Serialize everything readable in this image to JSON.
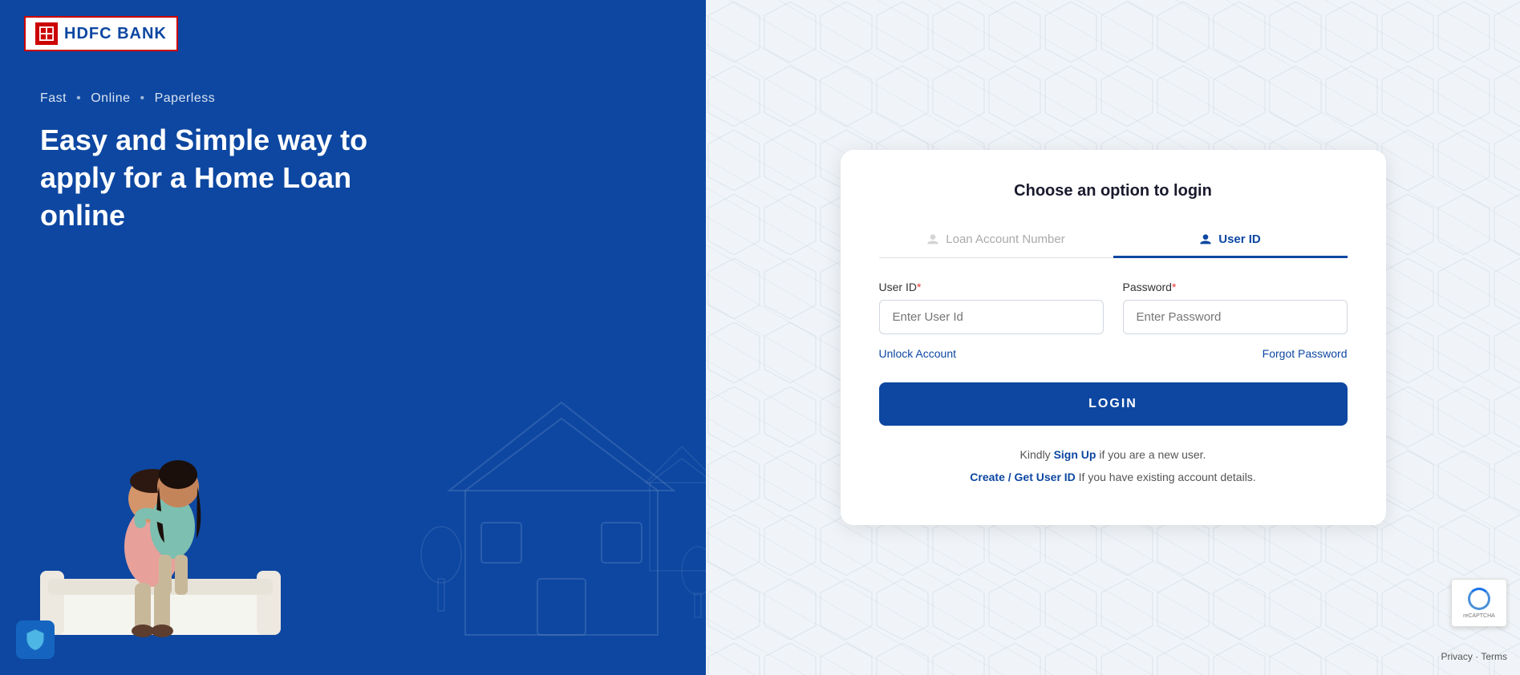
{
  "brand": {
    "name": "HDFC BANK",
    "logo_label": "HDFC BANK"
  },
  "left_panel": {
    "tagline_parts": [
      "Fast",
      "Online",
      "Paperless"
    ],
    "hero_text": "Easy and Simple way to apply for a Home Loan online"
  },
  "login_card": {
    "title": "Choose an option to login",
    "tabs": [
      {
        "id": "loan",
        "label": "Loan Account Number",
        "active": false
      },
      {
        "id": "userid",
        "label": "User ID",
        "active": true
      }
    ],
    "user_id_label": "User ID",
    "user_id_placeholder": "Enter User Id",
    "password_label": "Password",
    "password_placeholder": "Enter Password",
    "unlock_label": "Unlock Account",
    "forgot_label": "Forgot Password",
    "login_button": "LOGIN",
    "footer_line1_prefix": "Kindly ",
    "footer_signup": "Sign Up",
    "footer_line1_suffix": " if you are a new user.",
    "footer_create": "Create / Get User ID",
    "footer_line2_suffix": " If you have existing account details."
  },
  "privacy": {
    "privacy_text": "Privacy",
    "terms_text": "Terms"
  }
}
